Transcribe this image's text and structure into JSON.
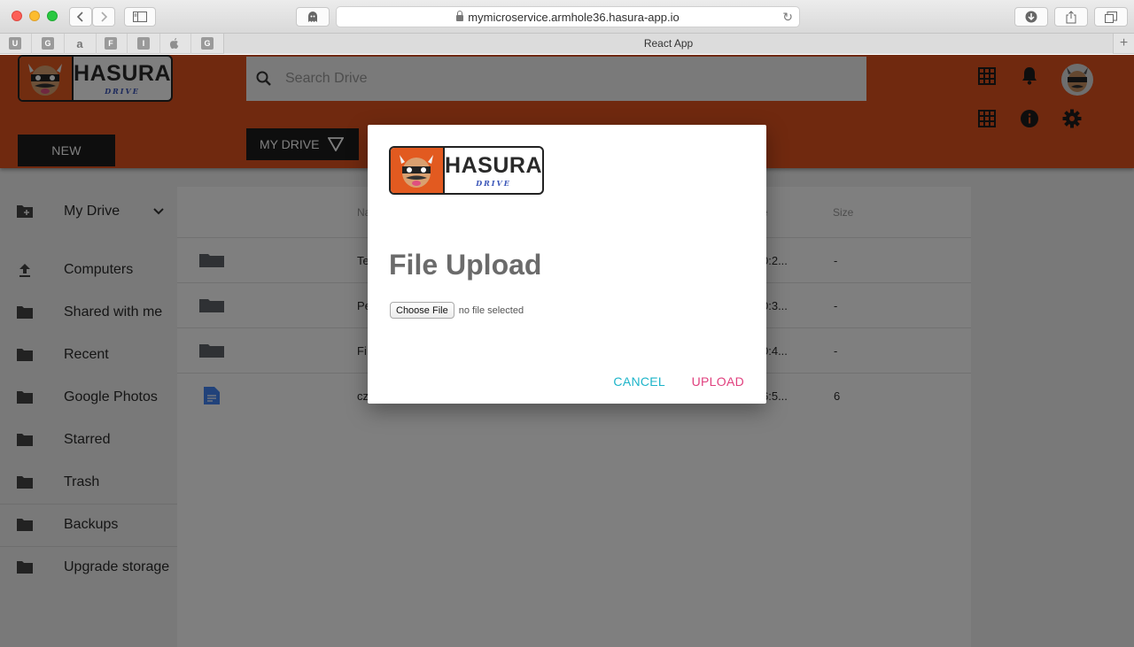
{
  "browser": {
    "url": "mymicroservice.armhole36.hasura-app.io",
    "tab_title": "React App",
    "favorites": [
      "U",
      "G",
      "a",
      "F",
      "I",
      "",
      "G"
    ]
  },
  "app": {
    "logo_word": "HASURA",
    "logo_sub": "DRIVE",
    "search_placeholder": "Search Drive",
    "new_button": "NEW",
    "my_drive_button": "MY DRIVE",
    "header_icons": [
      "apps-grid-icon",
      "bell-icon",
      "avatar",
      "apps-grid-icon",
      "info-icon",
      "gear-icon"
    ],
    "colors": {
      "header": "#e0521f",
      "button_dark": "#1d1d1d",
      "cancel": "#1db4c9",
      "upload": "#e0407e"
    }
  },
  "sidebar": {
    "items": [
      {
        "label": "My Drive",
        "icon": "folder-plus-icon"
      },
      {
        "label": "Computers",
        "icon": "upload-icon"
      },
      {
        "label": "Shared with me",
        "icon": "folder-icon"
      },
      {
        "label": "Recent",
        "icon": "folder-icon"
      },
      {
        "label": "Google Photos",
        "icon": "folder-icon"
      },
      {
        "label": "Starred",
        "icon": "folder-icon"
      },
      {
        "label": "Trash",
        "icon": "folder-icon"
      },
      {
        "label": "Backups",
        "icon": "folder-icon"
      },
      {
        "label": "Upgrade storage",
        "icon": "folder-icon"
      }
    ]
  },
  "table": {
    "headers": [
      "Na",
      "e",
      "Size"
    ],
    "rows": [
      {
        "icon": "folder-icon",
        "name": "Te",
        "modified": "0:2...",
        "size": "-"
      },
      {
        "icon": "folder-icon",
        "name": "Pe",
        "modified": "0:3...",
        "size": "-"
      },
      {
        "icon": "folder-icon",
        "name": "Fi",
        "modified": "0:4...",
        "size": "-"
      },
      {
        "icon": "document-icon",
        "name": "cz",
        "modified": "6:5...",
        "size": "6"
      }
    ]
  },
  "dialog": {
    "title": "File Upload",
    "choose_file": "Choose File",
    "no_file": "no file selected",
    "cancel": "CANCEL",
    "upload": "UPLOAD"
  }
}
